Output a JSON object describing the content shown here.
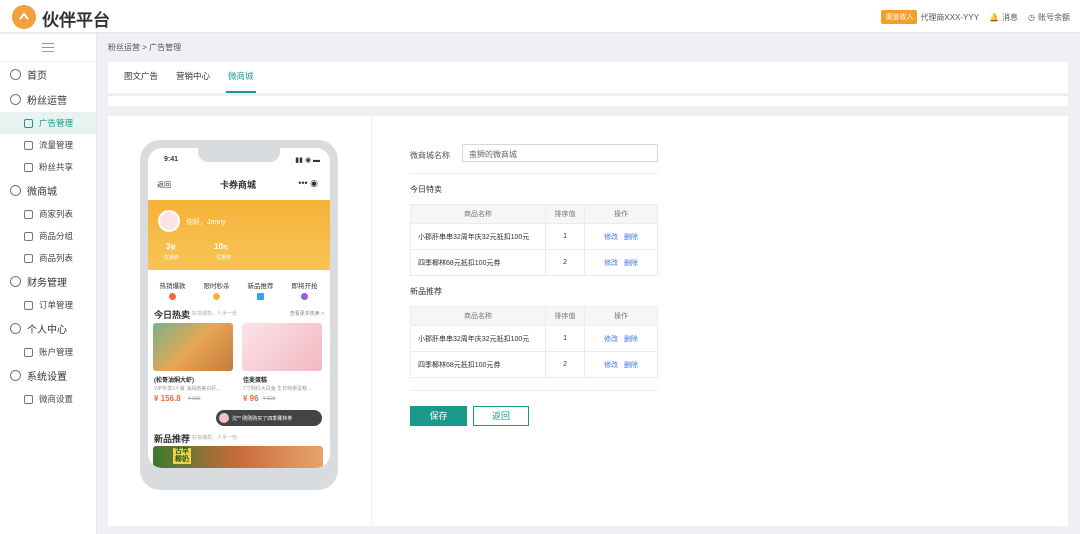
{
  "header": {
    "logo_text": "伙伴平台",
    "badge": "渠道收入",
    "agent": "代理商XXX-YYY",
    "messages": "消息",
    "balance": "账号余额"
  },
  "sidebar": {
    "items": [
      {
        "label": "首页",
        "icon": "home-icon",
        "level": 1
      },
      {
        "label": "粉丝运营",
        "icon": "target-icon",
        "level": 1
      },
      {
        "label": "广告管理",
        "icon": "ad-icon",
        "level": 2,
        "active": true
      },
      {
        "label": "流量管理",
        "icon": "traffic-icon",
        "level": 2
      },
      {
        "label": "粉丝共享",
        "icon": "heart-icon",
        "level": 2
      },
      {
        "label": "微商城",
        "icon": "store-icon",
        "level": 1
      },
      {
        "label": "商家列表",
        "icon": "layers-icon",
        "level": 2
      },
      {
        "label": "商品分组",
        "icon": "group-icon",
        "level": 2
      },
      {
        "label": "商品列表",
        "icon": "list-icon",
        "level": 2
      },
      {
        "label": "财务管理",
        "icon": "finance-icon",
        "level": 1
      },
      {
        "label": "订单管理",
        "icon": "order-icon",
        "level": 2
      },
      {
        "label": "个人中心",
        "icon": "user-icon",
        "level": 1
      },
      {
        "label": "账户管理",
        "icon": "account-icon",
        "level": 2
      },
      {
        "label": "系统设置",
        "icon": "gear-icon",
        "level": 1
      },
      {
        "label": "微商设置",
        "icon": "settings-icon",
        "level": 2
      }
    ]
  },
  "breadcrumb": {
    "a": "粉丝运营",
    "b": "广告管理"
  },
  "tabs": [
    "图文广告",
    "营销中心",
    "微商城"
  ],
  "phone": {
    "time": "9:41",
    "back": "返回",
    "title": "卡券商城",
    "greeting": "你好，Jenny",
    "stat1_val": "3",
    "stat1_unit": "张",
    "stat1_label": "优惠券",
    "stat2_val": "10",
    "stat2_unit": "元",
    "stat2_label": "优惠券",
    "features": [
      "热销爆款",
      "限时秒杀",
      "新品推荐",
      "即将开抢"
    ],
    "hot_title": "今日热卖",
    "hot_sub": "好货爆款，人手一份",
    "hot_more": "查看更多热卖 >",
    "p1_name": "(松哥油焖大虾)",
    "p1_desc": "VIP专享2人餐 油焖南美白虾...",
    "p1_price": "¥ 156.8",
    "p1_old": "¥ 399",
    "p2_name": "佳麦蛋糕",
    "p2_desc": "7寸网红大白兔 生日特惠蛋糕...",
    "p2_price": "¥ 96",
    "p2_old": "¥ 328",
    "new_title": "新品推荐",
    "new_sub": "好货爆款，人手一份",
    "toast": "沈** 刚刚购买了四季椰林券",
    "new_tag": "古早椰奶"
  },
  "form": {
    "name_label": "微商城名称",
    "name_value": "蛮狮的微商城",
    "sec1": "今日特卖",
    "sec2": "新品推荐",
    "col_name": "商品名称",
    "col_sort": "排序值",
    "col_op": "操作",
    "edit": "修改",
    "delete": "删除",
    "rows1": [
      {
        "name": "小郡肝串串32周年庆32元抵扣100元",
        "sort": "1"
      },
      {
        "name": "四季椰林68元抵扣100元券",
        "sort": "2"
      }
    ],
    "rows2": [
      {
        "name": "小郡肝串串32周年庆32元抵扣100元",
        "sort": "1"
      },
      {
        "name": "四季椰林68元抵扣100元券",
        "sort": "2"
      }
    ],
    "save": "保存",
    "back": "返回"
  },
  "colors": {
    "accent": "#1a9a8a",
    "brand": "#f2a03d"
  }
}
